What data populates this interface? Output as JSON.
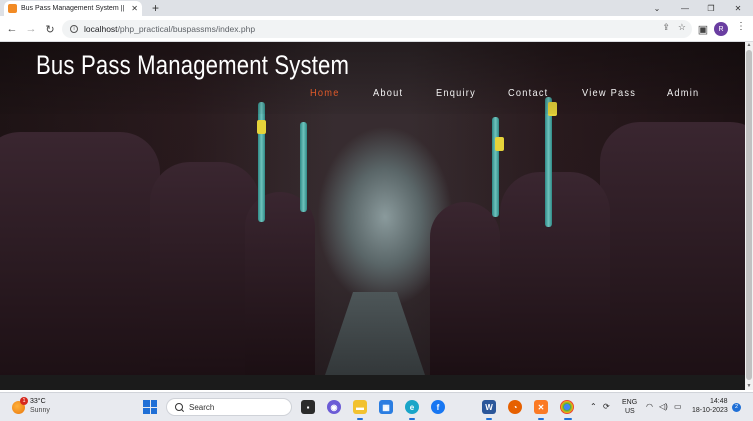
{
  "browser": {
    "tab_title": "Bus Pass Management System ||",
    "tab_close": "✕",
    "new_tab": "+",
    "url_host": "localhost",
    "url_path": "/php_practical/buspassms/index.php",
    "profile_initial": "R"
  },
  "site": {
    "title": "Bus Pass Management System",
    "nav": [
      {
        "label": "Home",
        "active": true
      },
      {
        "label": "About",
        "active": false
      },
      {
        "label": "Enquiry",
        "active": false
      },
      {
        "label": "Contact",
        "active": false
      },
      {
        "label": "View Pass",
        "active": false
      },
      {
        "label": "Admin",
        "active": false
      }
    ],
    "active_color": "#e05a2a"
  },
  "taskbar": {
    "weather_badge": "1",
    "temperature": "33°C",
    "weather": "Sunny",
    "search_placeholder": "Search",
    "lang_primary": "ENG",
    "lang_secondary": "US",
    "time": "14:48",
    "date": "18-10-2023",
    "notification_count": "2"
  }
}
